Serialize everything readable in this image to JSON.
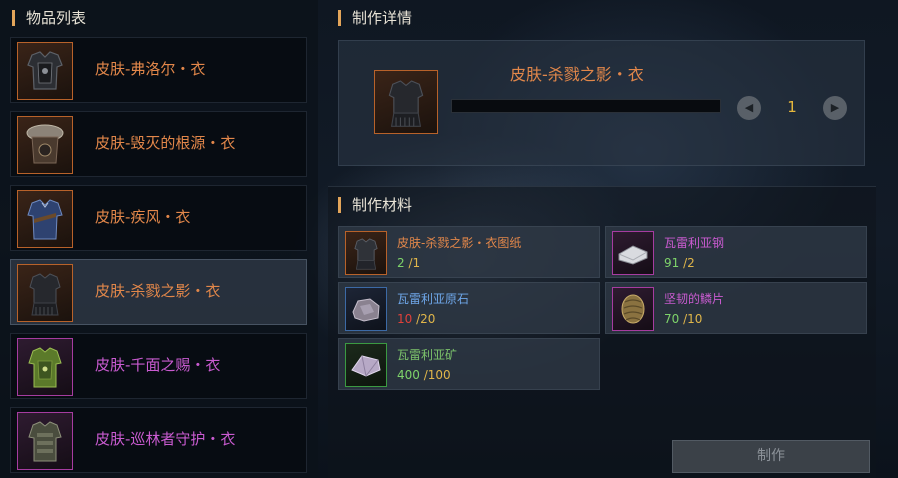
{
  "item_list": {
    "title": "物品列表",
    "items": [
      {
        "name": "皮肤-弗洛尔・衣",
        "rarity": "orange",
        "icon": "dark-armor-icon"
      },
      {
        "name": "皮肤-毁灭的根源・衣",
        "rarity": "orange",
        "icon": "fur-armor-icon"
      },
      {
        "name": "皮肤-疾风・衣",
        "rarity": "orange",
        "icon": "blue-coat-icon"
      },
      {
        "name": "皮肤-杀戮之影・衣",
        "rarity": "orange",
        "icon": "shadow-armor-icon",
        "selected": true
      },
      {
        "name": "皮肤-千面之赐・衣",
        "rarity": "purple",
        "icon": "green-coat-icon"
      },
      {
        "name": "皮肤-巡林者守护・衣",
        "rarity": "purple",
        "icon": "ranger-armor-icon"
      }
    ]
  },
  "detail": {
    "title": "制作详情",
    "item_name": "皮肤-杀戮之影・衣",
    "quantity": "1",
    "prev_icon": "left-arrow-icon",
    "next_icon": "right-arrow-icon"
  },
  "materials": {
    "title": "制作材料",
    "items": [
      {
        "name": "皮肤-杀戮之影・衣图纸",
        "have": "2",
        "sep": "/",
        "need": "1",
        "rarity": "orange",
        "icon": "blueprint-icon"
      },
      {
        "name": "瓦雷利亚钢",
        "have": "91",
        "sep": "/",
        "need": "2",
        "rarity": "purple",
        "icon": "steel-ingot-icon"
      },
      {
        "name": "瓦雷利亚原石",
        "have": "10",
        "sep": "/",
        "need": "20",
        "rarity": "blue",
        "icon": "ore-rock-icon"
      },
      {
        "name": "坚韧的鳞片",
        "have": "70",
        "sep": "/",
        "need": "10",
        "rarity": "purple",
        "icon": "scale-icon"
      },
      {
        "name": "瓦雷利亚矿",
        "have": "400",
        "sep": "/",
        "need": "100",
        "rarity": "green",
        "icon": "crystal-ore-icon"
      }
    ]
  },
  "craft_button": {
    "label": "制作"
  },
  "colors": {
    "accent": "#e3a55a",
    "orange": "#e2874a",
    "purple": "#c95bd0",
    "blue": "#6ea6e8",
    "green": "#7cc36b",
    "count_ok": "#7ed36a",
    "count_short": "#e0413a",
    "quantity": "#e6b83c"
  }
}
